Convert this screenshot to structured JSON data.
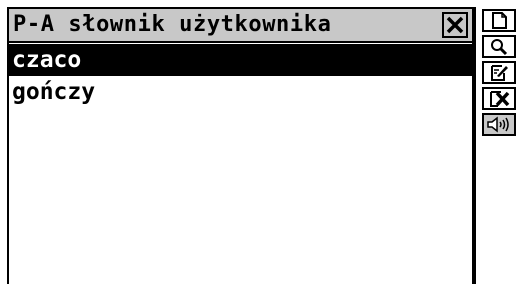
{
  "window": {
    "title": "P-A słownik użytkownika"
  },
  "list": {
    "items": [
      {
        "label": "czaco",
        "selected": true
      },
      {
        "label": "gończy",
        "selected": false
      }
    ]
  },
  "toolbar": {
    "tools": [
      {
        "icon": "new-document-icon"
      },
      {
        "icon": "search-icon"
      },
      {
        "icon": "edit-icon"
      },
      {
        "icon": "delete-icon"
      },
      {
        "icon": "speaker-icon",
        "active": true
      }
    ]
  },
  "colors": {
    "titlebar": "#c8c8c8",
    "selection": "#000000",
    "background": "#ffffff"
  }
}
